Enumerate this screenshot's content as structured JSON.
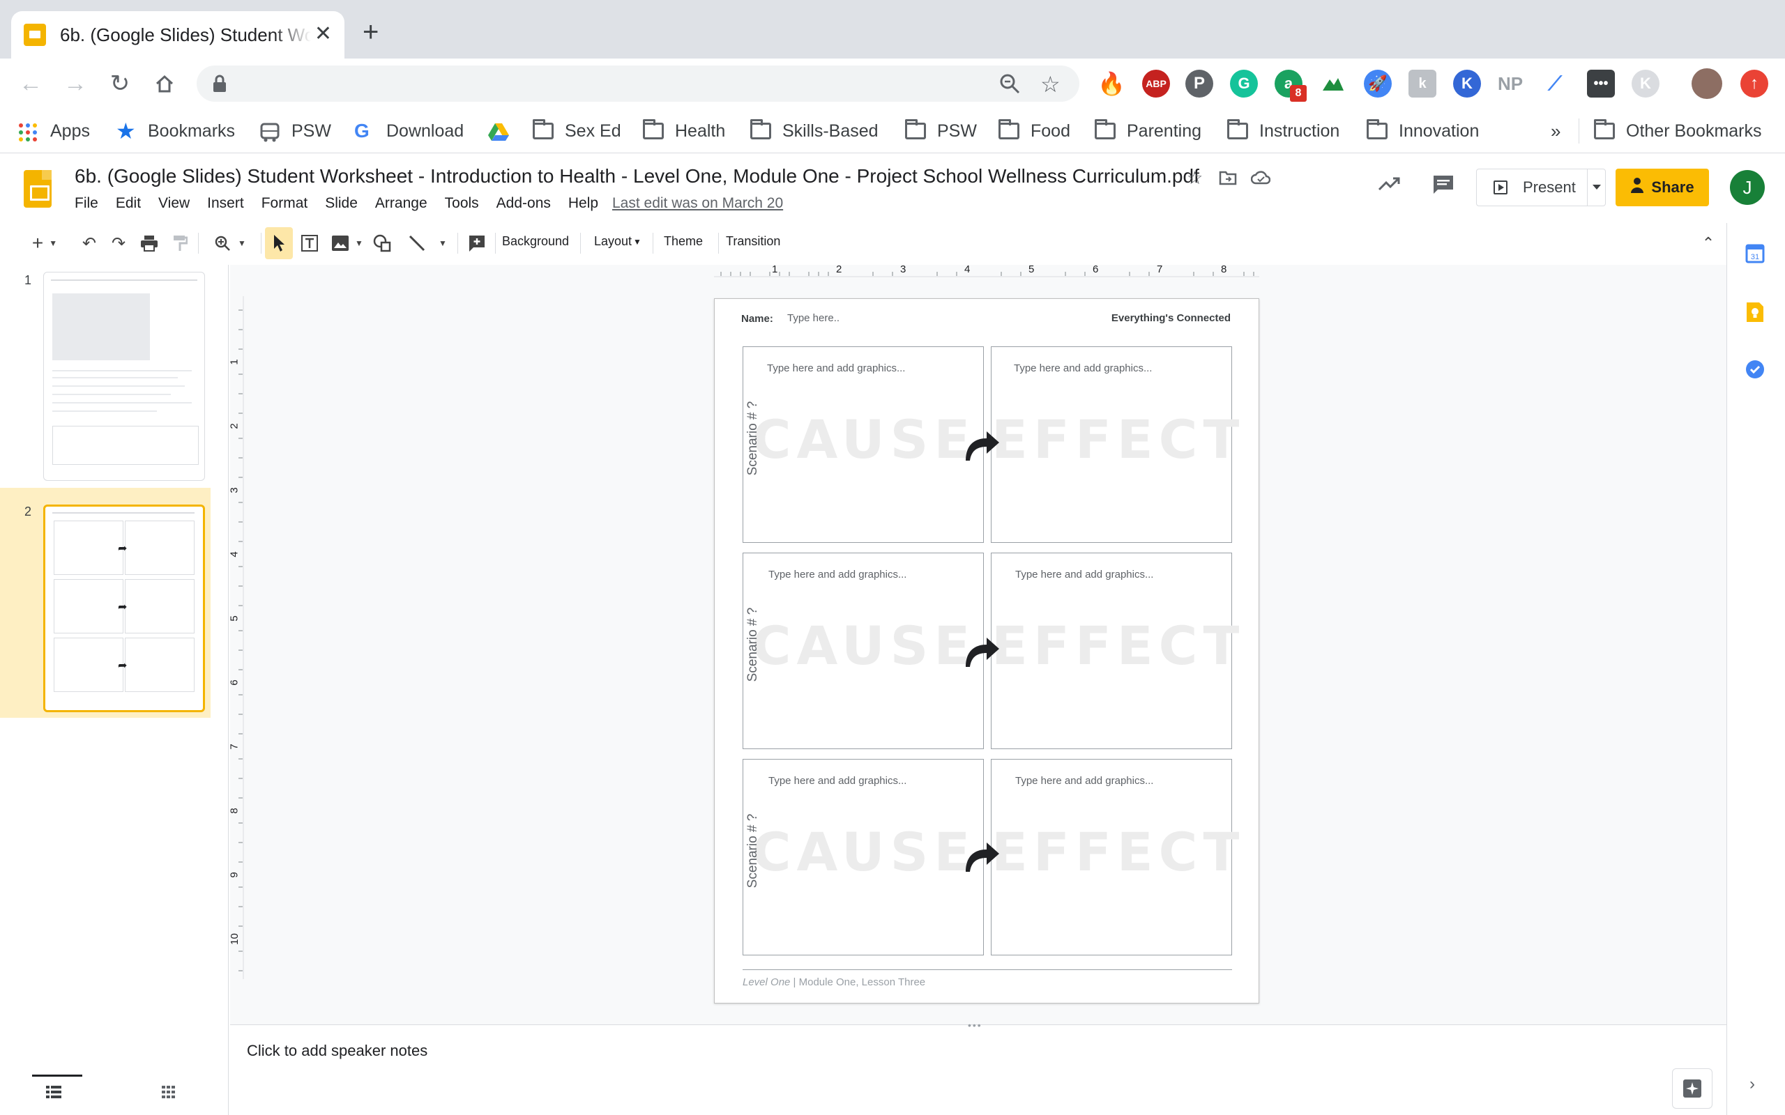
{
  "browser": {
    "tab_title": "6b. (Google Slides) Student Worksheet - Introduction to Health - Level One, Module One - Project School Wellness Curriculum.pdf",
    "tab_title_visible": "6b. (Google Slides) Student W",
    "extension_badge_count": "8"
  },
  "bookmarks": {
    "apps": "Apps",
    "items": [
      "Bookmarks",
      "PSW",
      "Download",
      "",
      "Sex Ed",
      "Health",
      "Skills-Based",
      "PSW",
      "Food",
      "Parenting",
      "Instruction",
      "Innovation"
    ],
    "overflow": "»",
    "other": "Other Bookmarks"
  },
  "document": {
    "title": "6b. (Google Slides) Student Worksheet - Introduction to Health - Level One, Module One - Project School Wellness Curriculum.pdf",
    "menu": [
      "File",
      "Edit",
      "View",
      "Insert",
      "Format",
      "Slide",
      "Arrange",
      "Tools",
      "Add-ons",
      "Help"
    ],
    "last_edit": "Last edit was on March 20",
    "present_label": "Present",
    "share_label": "Share",
    "user_initial": "J"
  },
  "toolbar": {
    "background": "Background",
    "layout": "Layout",
    "theme": "Theme",
    "transition": "Transition"
  },
  "rulers": {
    "horizontal": [
      "1",
      "2",
      "3",
      "4",
      "5",
      "6",
      "7",
      "8"
    ],
    "vertical": [
      "1",
      "2",
      "3",
      "4",
      "5",
      "6",
      "7",
      "8",
      "9",
      "10"
    ]
  },
  "filmstrip": {
    "slide_numbers": [
      "1",
      "2"
    ],
    "selected": 2
  },
  "slide": {
    "name_label": "Name:",
    "name_placeholder": "Type here..",
    "heading": "Everything's Connected",
    "box_hint": "Type here and add graphics...",
    "cause_word": "CAUSE",
    "effect_word": "EFFECT",
    "scenario_label": "Scenario # ?",
    "footer_level": "Level One",
    "footer_rest": " | Module One, Lesson Three"
  },
  "notes": {
    "placeholder": "Click to add speaker notes"
  },
  "colors": {
    "slides_yellow": "#f4b400",
    "share_button": "#fbbc04",
    "selected_slide_bg": "#feefc3",
    "avatar_green": "#188038"
  }
}
